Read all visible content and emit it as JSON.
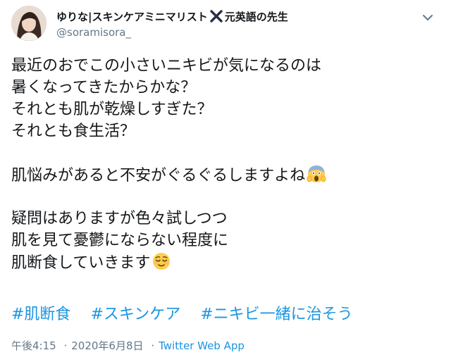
{
  "user": {
    "display_name": "ゆりな|スキンケアミニマリスト",
    "display_name_suffix": "元英語の先生",
    "handle": "@soramisora_"
  },
  "tweet": {
    "lines_1": [
      "最近のおでこの小さいニキビが気になるのは",
      "暑くなってきたからかな？",
      "それとも肌が乾燥しすぎた？",
      "それとも食生活？"
    ],
    "line_2": "肌悩みがあると不安がぐるぐるしますよね",
    "lines_3": [
      "疑問はありますが色々試しつつ",
      "肌を見て憂鬱にならない程度に"
    ],
    "line_4": "肌断食していきます",
    "hashtags": [
      "#肌断食",
      "#スキンケア",
      "#ニキビ一緒に治そう"
    ]
  },
  "meta": {
    "time": "午後4:15",
    "date": "2020年6月8日",
    "separator": "·",
    "source": "Twitter Web App"
  },
  "icons": {
    "verified_mark": "cross-x-icon",
    "more": "chevron-down-icon",
    "emoji_1": "screaming-face-emoji",
    "emoji_2": "relieved-face-emoji"
  },
  "colors": {
    "text": "#14171a",
    "secondary": "#657786",
    "link": "#1b95e0"
  }
}
